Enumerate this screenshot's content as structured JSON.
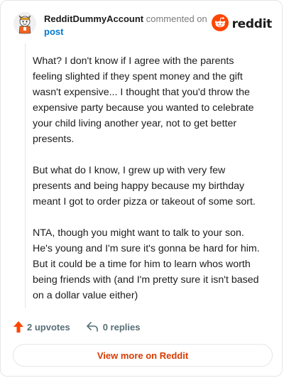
{
  "header": {
    "username": "RedditDummyAccount",
    "action_text": "commented on",
    "post_link": "post",
    "brand_name": "reddit"
  },
  "comment": {
    "paragraphs": [
      "What? I don't know if I agree with the parents feeling slighted if they spent money and the gift wasn't expensive... I thought that you'd throw the expensive party because you wanted to celebrate your child living another year, not to get better presents.",
      "But what do I know, I grew up with very few presents and being happy because my birthday meant I got to order pizza or takeout of some sort.",
      "NTA, though you might want to talk to your son. He's young and I'm sure it's gonna be hard for him. But it could be a time for him to learn whos worth being friends with (and I'm pretty sure it isn't based on a dollar value either)"
    ]
  },
  "actions": {
    "upvotes": "2 upvotes",
    "replies": "0 replies"
  },
  "footer": {
    "view_more": "View more on Reddit"
  },
  "colors": {
    "brand_orange": "#ff4500",
    "link_blue": "#0079d3",
    "view_more_text": "#d93a00"
  },
  "icons": {
    "avatar": "avatar-snoo-icon",
    "brand": "reddit-logo-icon",
    "upvote": "upvote-arrow-icon",
    "reply": "reply-arrow-icon"
  }
}
